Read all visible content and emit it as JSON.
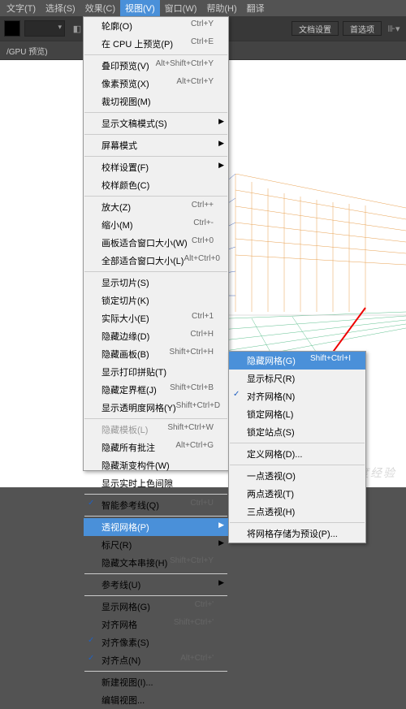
{
  "menubar": {
    "items": [
      "文字(T)",
      "选择(S)",
      "效果(C)",
      "视图(V)",
      "窗口(W)",
      "帮助(H)",
      "翻译"
    ],
    "activeIndex": 3
  },
  "toolbar": {
    "docset": "文档设置",
    "prefs": "首选项"
  },
  "panel": {
    "gpu": "/GPU 预览)"
  },
  "viewMenu": [
    {
      "t": "轮廓(O)",
      "s": "Ctrl+Y"
    },
    {
      "t": "在 CPU 上预览(P)",
      "s": "Ctrl+E"
    },
    {
      "sep": 1
    },
    {
      "t": "叠印预览(V)",
      "s": "Alt+Shift+Ctrl+Y"
    },
    {
      "t": "像素预览(X)",
      "s": "Alt+Ctrl+Y"
    },
    {
      "t": "裁切视图(M)"
    },
    {
      "sep": 1
    },
    {
      "t": "显示文稿模式(S)",
      "sub": 1
    },
    {
      "sep": 1
    },
    {
      "t": "屏幕模式",
      "sub": 1
    },
    {
      "sep": 1
    },
    {
      "t": "校样设置(F)",
      "sub": 1
    },
    {
      "t": "校样颜色(C)"
    },
    {
      "sep": 1
    },
    {
      "t": "放大(Z)",
      "s": "Ctrl++"
    },
    {
      "t": "缩小(M)",
      "s": "Ctrl+-"
    },
    {
      "t": "画板适合窗口大小(W)",
      "s": "Ctrl+0"
    },
    {
      "t": "全部适合窗口大小(L)",
      "s": "Alt+Ctrl+0"
    },
    {
      "sep": 1
    },
    {
      "t": "显示切片(S)"
    },
    {
      "t": "锁定切片(K)"
    },
    {
      "t": "实际大小(E)",
      "s": "Ctrl+1"
    },
    {
      "t": "隐藏边缘(D)",
      "s": "Ctrl+H"
    },
    {
      "t": "隐藏画板(B)",
      "s": "Shift+Ctrl+H"
    },
    {
      "t": "显示打印拼贴(T)"
    },
    {
      "t": "隐藏定界框(J)",
      "s": "Shift+Ctrl+B"
    },
    {
      "t": "显示透明度网格(Y)",
      "s": "Shift+Ctrl+D"
    },
    {
      "sep": 1
    },
    {
      "t": "隐藏模板(L)",
      "s": "Shift+Ctrl+W",
      "dis": 1
    },
    {
      "t": "隐藏所有批注",
      "s": "Alt+Ctrl+G"
    },
    {
      "t": "隐藏渐变构件(W)"
    },
    {
      "t": "显示实时上色间隙"
    },
    {
      "sep": 1
    },
    {
      "t": "智能参考线(Q)",
      "s": "Ctrl+U",
      "chk": 1
    },
    {
      "sep": 1
    },
    {
      "t": "透视网格(P)",
      "sub": 1,
      "hl": 1
    },
    {
      "t": "标尺(R)",
      "sub": 1
    },
    {
      "t": "隐藏文本串接(H)",
      "s": "Shift+Ctrl+Y"
    },
    {
      "sep": 1
    },
    {
      "t": "参考线(U)",
      "sub": 1
    },
    {
      "sep": 1
    },
    {
      "t": "显示网格(G)",
      "s": "Ctrl+'"
    },
    {
      "t": "对齐网格",
      "s": "Shift+Ctrl+'"
    },
    {
      "t": "对齐像素(S)",
      "chk": 1
    },
    {
      "t": "对齐点(N)",
      "s": "Alt+Ctrl+'",
      "chk": 1
    },
    {
      "sep": 1
    },
    {
      "t": "新建视图(I)..."
    },
    {
      "t": "编辑视图..."
    }
  ],
  "subMenu": [
    {
      "t": "隐藏网格(G)",
      "s": "Shift+Ctrl+I",
      "hl": 1
    },
    {
      "t": "显示标尺(R)"
    },
    {
      "t": "对齐网格(N)",
      "chk": 1
    },
    {
      "t": "锁定网格(L)"
    },
    {
      "t": "锁定站点(S)"
    },
    {
      "sep": 1
    },
    {
      "t": "定义网格(D)..."
    },
    {
      "sep": 1
    },
    {
      "t": "一点透视(O)"
    },
    {
      "t": "两点透视(T)"
    },
    {
      "t": "三点透视(H)"
    },
    {
      "sep": 1
    },
    {
      "t": "将网格存储为预设(P)..."
    }
  ],
  "watermark": "百度经验"
}
